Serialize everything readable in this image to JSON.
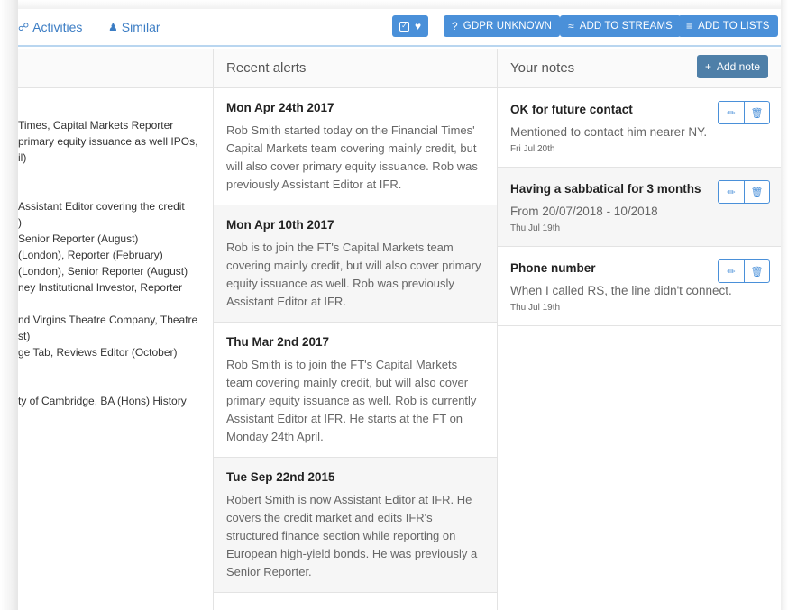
{
  "tabs": [
    {
      "label": "Activities",
      "icon": "binoculars-icon"
    },
    {
      "label": "Similar",
      "icon": "users-icon"
    }
  ],
  "toolbar": {
    "gdpr_label": "GDPR UNKNOWN",
    "streams_label": "ADD TO STREAMS",
    "lists_label": "ADD TO LISTS",
    "accent": "#4a90d9"
  },
  "bio": {
    "lines": [
      "Times, Capital Markets Reporter",
      "primary equity issuance as well IPOs,",
      "il)",
      "Assistant Editor covering the credit",
      ")",
      "Senior Reporter (August)",
      "(London), Reporter (February)",
      "(London), Senior Reporter (August)",
      "ney Institutional Investor, Reporter",
      "nd Virgins Theatre Company, Theatre",
      "st)",
      "ge Tab, Reviews Editor (October)",
      "ty of Cambridge, BA (Hons) History"
    ]
  },
  "alerts": {
    "heading": "Recent alerts",
    "items": [
      {
        "date": "Mon Apr 24th 2017",
        "text": "Rob Smith started today on the Financial Times' Capital Markets team covering mainly credit, but will also cover primary equity issuance. Rob was previously Assistant Editor at IFR."
      },
      {
        "date": "Mon Apr 10th 2017",
        "text": "Rob is to join the FT's Capital Markets team covering mainly credit, but will also cover primary equity issuance as well. Rob was previously Assistant Editor at IFR."
      },
      {
        "date": "Thu Mar 2nd 2017",
        "text": "Rob Smith is to join the FT's Capital Markets team covering mainly credit, but will also cover primary equity issuance as well. Rob is currently Assistant Editor at IFR. He starts at the FT on Monday 24th April."
      },
      {
        "date": "Tue Sep 22nd 2015",
        "text": "Robert Smith is now Assistant Editor at IFR. He covers the credit market and edits IFR's structured finance section while reporting on European high-yield bonds. He was previously a Senior Reporter."
      }
    ]
  },
  "notes": {
    "heading": "Your notes",
    "add_label": "Add note",
    "items": [
      {
        "title": "OK for future contact",
        "body": "Mentioned to contact him nearer NY.",
        "date": "Fri Jul 20th"
      },
      {
        "title": "Having a sabbatical for 3 months",
        "body": "From 20/07/2018 - 10/2018",
        "date": "Thu Jul 19th"
      },
      {
        "title": "Phone number",
        "body": "When I called RS, the line didn't connect.",
        "date": "Thu Jul 19th"
      }
    ]
  }
}
